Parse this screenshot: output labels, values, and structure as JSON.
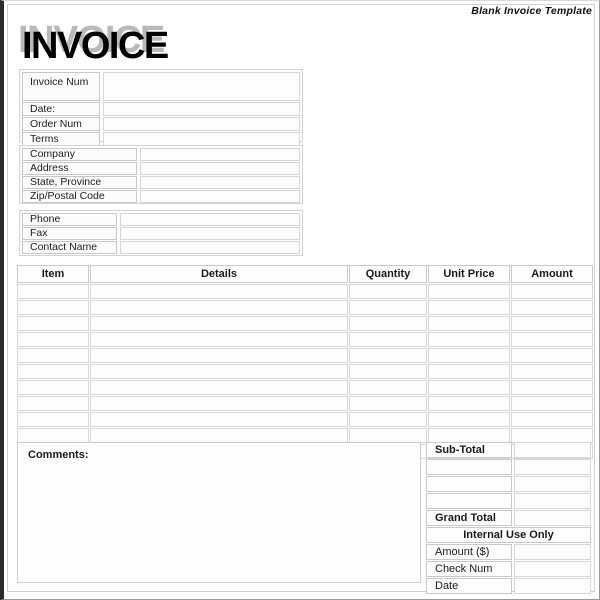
{
  "document": {
    "header_note": "Blank Invoice Template",
    "title": "INVOICE"
  },
  "invoice_block": {
    "rows": [
      {
        "label": "Invoice Num",
        "value": ""
      },
      {
        "label": "Date:",
        "value": ""
      },
      {
        "label": "Order Num",
        "value": ""
      },
      {
        "label": "Terms",
        "value": ""
      }
    ]
  },
  "company_block": {
    "rows": [
      {
        "label": "Company",
        "value": ""
      },
      {
        "label": "Address",
        "value": ""
      },
      {
        "label": "State, Province",
        "value": ""
      },
      {
        "label": "Zip/Postal Code",
        "value": ""
      }
    ]
  },
  "contact_block": {
    "rows": [
      {
        "label": "Phone",
        "value": ""
      },
      {
        "label": "Fax",
        "value": ""
      },
      {
        "label": "Contact Name",
        "value": ""
      }
    ]
  },
  "items_table": {
    "columns": [
      "Item",
      "Details",
      "Quantity",
      "Unit Price",
      "Amount"
    ],
    "row_count": 11,
    "rows": [
      {
        "item": "",
        "details": "",
        "quantity": "",
        "unit_price": "",
        "amount": ""
      },
      {
        "item": "",
        "details": "",
        "quantity": "",
        "unit_price": "",
        "amount": ""
      },
      {
        "item": "",
        "details": "",
        "quantity": "",
        "unit_price": "",
        "amount": ""
      },
      {
        "item": "",
        "details": "",
        "quantity": "",
        "unit_price": "",
        "amount": ""
      },
      {
        "item": "",
        "details": "",
        "quantity": "",
        "unit_price": "",
        "amount": ""
      },
      {
        "item": "",
        "details": "",
        "quantity": "",
        "unit_price": "",
        "amount": ""
      },
      {
        "item": "",
        "details": "",
        "quantity": "",
        "unit_price": "",
        "amount": ""
      },
      {
        "item": "",
        "details": "",
        "quantity": "",
        "unit_price": "",
        "amount": ""
      },
      {
        "item": "",
        "details": "",
        "quantity": "",
        "unit_price": "",
        "amount": ""
      },
      {
        "item": "",
        "details": "",
        "quantity": "",
        "unit_price": "",
        "amount": ""
      },
      {
        "item": "",
        "details": "",
        "quantity": "",
        "unit_price": "",
        "amount": ""
      }
    ]
  },
  "comments": {
    "label": "Comments:",
    "value": ""
  },
  "totals": {
    "sub_total_label": "Sub-Total",
    "sub_total_value": "",
    "blank_rows": 3,
    "grand_total_label": "Grand Total",
    "grand_total_value": "",
    "internal_header": "Internal Use Only",
    "internal_rows": [
      {
        "label": "Amount ($)",
        "value": ""
      },
      {
        "label": "Check Num",
        "value": ""
      },
      {
        "label": "Date",
        "value": ""
      }
    ]
  },
  "colors": {
    "page_background": "#ffffff",
    "frame_border": "#2b2b2b",
    "cell_border": "#d3d3d3",
    "cell_fill": "#fdfdfd",
    "text": "#1a1a1a",
    "title_shadow": "#b9b9b9"
  }
}
